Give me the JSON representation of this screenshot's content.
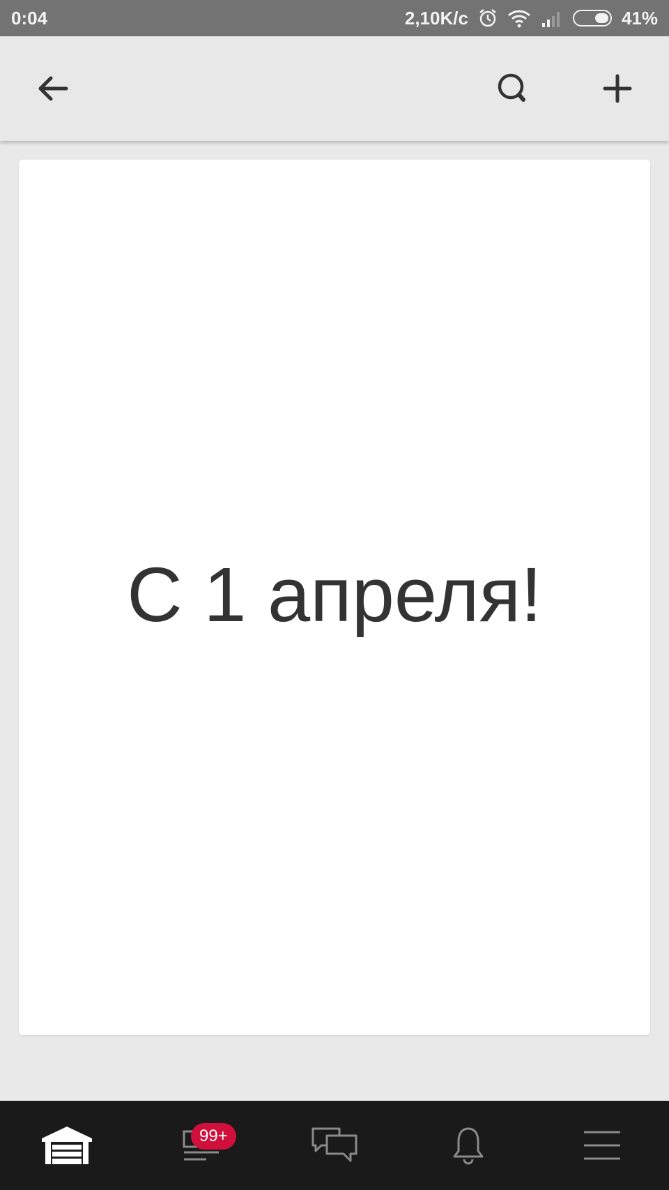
{
  "status_bar": {
    "time": "0:04",
    "network_speed": "2,10K/c",
    "battery": "41%",
    "battery_level": 0.41,
    "icons": [
      "alarm-icon",
      "wifi-icon",
      "signal-icon",
      "battery-icon"
    ]
  },
  "app_bar": {
    "icons": [
      "arrow-left-icon",
      "search-icon",
      "plus-icon"
    ]
  },
  "content": {
    "message": "С 1 апреля!"
  },
  "bottom_nav": {
    "items": [
      {
        "icon": "garage-icon",
        "active": true
      },
      {
        "icon": "feed-icon",
        "badge": "99+"
      },
      {
        "icon": "chat-icon"
      },
      {
        "icon": "bell-icon"
      },
      {
        "icon": "menu-icon"
      }
    ],
    "badge_color": "#d0103a"
  },
  "colors": {
    "status_bar": "#737373",
    "app_bar": "#e8e8e8",
    "background": "#e9e9e9",
    "card": "#ffffff",
    "text": "#333333",
    "bottom_nav": "#1a1a1a"
  }
}
